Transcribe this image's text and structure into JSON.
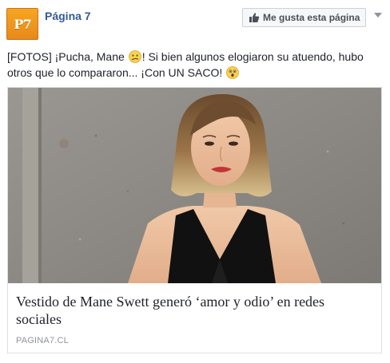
{
  "header": {
    "logo_text": "P7",
    "page_name": "Página 7",
    "like_button_label": "Me gusta esta página",
    "like_icon": "thumbs-up-icon",
    "menu_icon": "chevron-down-icon"
  },
  "post": {
    "text_part1": "[FOTOS] ¡Pucha, Mane ",
    "emoji1": "confused-face-emoji",
    "text_part2": "! Si bien algunos elogiaron su atuendo, hubo otros que lo compararon... ¡Con UN SACO! ",
    "emoji2": "astonished-face-emoji"
  },
  "link_preview": {
    "image": "photo-woman-black-dress",
    "title": "Vestido de Mane Swett generó ‘amor y odio’ en redes sociales",
    "domain": "PAGINA7.CL"
  },
  "colors": {
    "brand_blue": "#365899",
    "logo_orange": "#f5a623",
    "button_bg": "#f6f7f9",
    "border": "#dddfe2",
    "muted_text": "#90949c"
  }
}
